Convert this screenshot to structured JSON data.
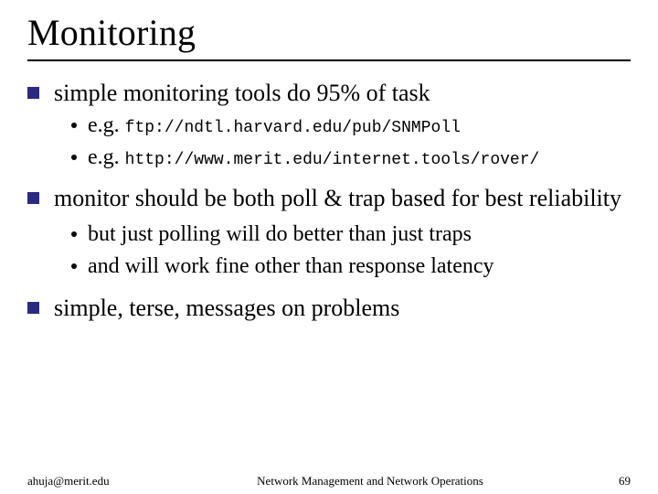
{
  "title": "Monitoring",
  "bullets": {
    "b1": {
      "text": "simple monitoring tools do 95% of task"
    },
    "b1a": {
      "prefix": "e.g. ",
      "mono": "ftp://ndtl.harvard.edu/pub/SNMPoll"
    },
    "b1b": {
      "prefix": "e.g. ",
      "mono": "http://www.merit.edu/internet.tools/rover/"
    },
    "b2": {
      "text": "monitor should be both poll & trap based for best reliability"
    },
    "b2a": {
      "text": "but just polling will do better than just traps"
    },
    "b2b": {
      "text": "and will work fine other than response latency"
    },
    "b3": {
      "text": "simple, terse, messages on problems"
    }
  },
  "footer": {
    "left": "ahuja@merit.edu",
    "center": "Network Management and Network Operations",
    "right": "69"
  }
}
